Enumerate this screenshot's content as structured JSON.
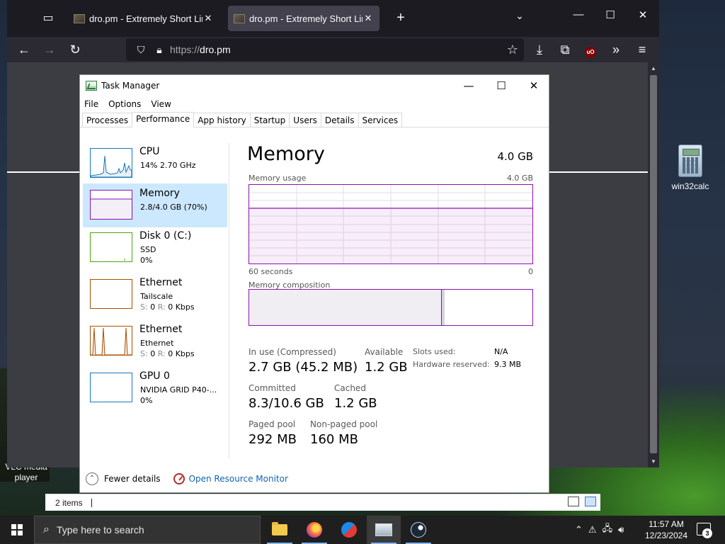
{
  "desktop": {
    "icons": [
      {
        "label": "win32calc",
        "icon": "calculator-icon"
      }
    ],
    "vlc_label": "VLC media player"
  },
  "browser": {
    "tabs": [
      {
        "title": "dro.pm - Extremely Short Links",
        "active": false
      },
      {
        "title": "dro.pm - Extremely Short Links",
        "active": true
      }
    ],
    "tab_close_glyph": "✕",
    "new_tab_glyph": "+",
    "url_scheme": "https://",
    "url_host": "dro.pm",
    "addon_badge": "uO"
  },
  "explorer": {
    "status_items": "2 items"
  },
  "taskmgr": {
    "title": "Task Manager",
    "menu": [
      "File",
      "Options",
      "View"
    ],
    "tabs": [
      "Processes",
      "Performance",
      "App history",
      "Startup",
      "Users",
      "Details",
      "Services"
    ],
    "active_tab": "Performance",
    "resources": [
      {
        "name": "CPU",
        "sub1": "14%  2.70 GHz",
        "sub2": "",
        "color": "#1779ba"
      },
      {
        "name": "Memory",
        "sub1": "2.8/4.0 GB (70%)",
        "sub2": "",
        "color": "#8b12ae"
      },
      {
        "name": "Disk 0 (C:)",
        "sub1": "SSD",
        "sub2": "0%",
        "color": "#4da60c"
      },
      {
        "name": "Ethernet",
        "sub1": "Tailscale",
        "sub2_label_s": "S:",
        "sub2_s": "0",
        "sub2_label_r": "R:",
        "sub2_r": "0 Kbps",
        "color": "#a74f01"
      },
      {
        "name": "Ethernet",
        "sub1": "Ethernet",
        "sub2_label_s": "S:",
        "sub2_s": "0",
        "sub2_label_r": "R:",
        "sub2_r": "0 Kbps",
        "color": "#a74f01"
      },
      {
        "name": "GPU 0",
        "sub1": "NVIDIA GRID P40-...",
        "sub2": "0%",
        "color": "#1779ba"
      }
    ],
    "detail": {
      "title": "Memory",
      "total": "4.0 GB",
      "usage_label": "Memory usage",
      "usage_max": "4.0 GB",
      "axis_left": "60 seconds",
      "axis_right": "0",
      "composition_label": "Memory composition",
      "usage_fraction": 0.7,
      "composition": {
        "in_use_fraction": 0.68,
        "modified_fraction": 0.01
      },
      "stats": {
        "in_use_label": "In use (Compressed)",
        "in_use_value": "2.7 GB (45.2 MB)",
        "available_label": "Available",
        "available_value": "1.2 GB",
        "committed_label": "Committed",
        "committed_value": "8.3/10.6 GB",
        "cached_label": "Cached",
        "cached_value": "1.2 GB",
        "paged_label": "Paged pool",
        "paged_value": "292 MB",
        "nonpaged_label": "Non-paged pool",
        "nonpaged_value": "160 MB",
        "slots_label": "Slots used:",
        "slots_value": "N/A",
        "hw_reserved_label": "Hardware reserved:",
        "hw_reserved_value": "9.3 MB"
      }
    },
    "footer": {
      "fewer_details": "Fewer details",
      "resource_monitor": "Open Resource Monitor"
    }
  },
  "taskbar": {
    "search_placeholder": "Type here to search",
    "clock_time": "11:57 AM",
    "clock_date": "12/23/2024",
    "notification_count": "3",
    "apps": [
      "file-explorer",
      "firefox",
      "qq",
      "task-manager",
      "steam"
    ]
  }
}
